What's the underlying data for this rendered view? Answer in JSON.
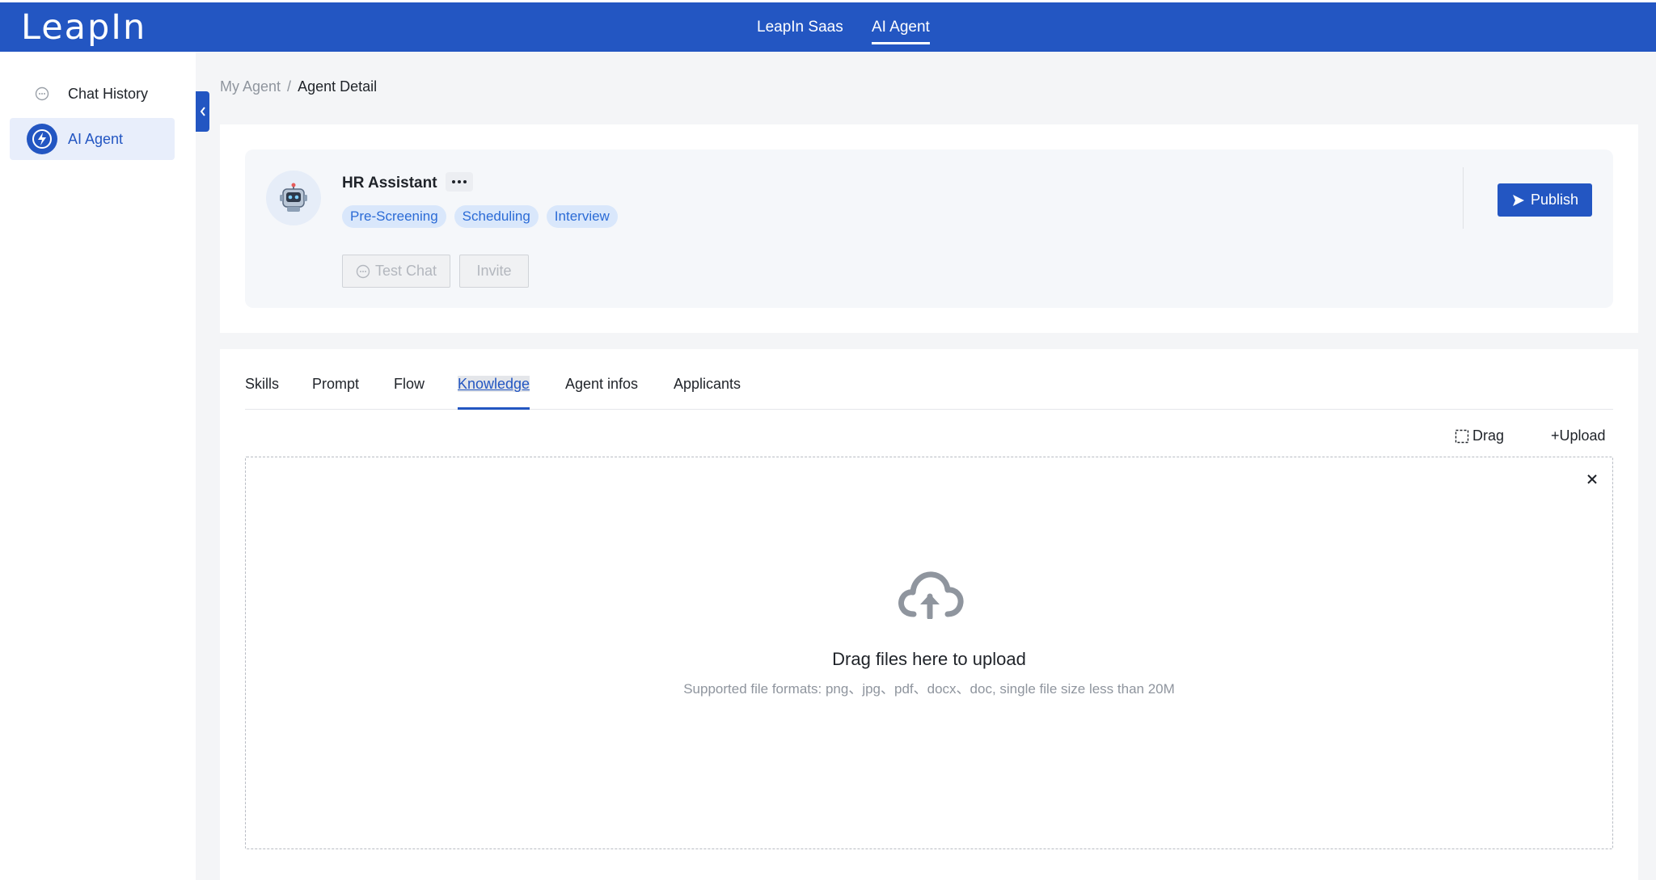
{
  "brand": {
    "logo": "LeapIn"
  },
  "topnav": {
    "items": [
      {
        "label": "LeapIn Saas"
      },
      {
        "label": "AI Agent"
      }
    ]
  },
  "sidebar": {
    "items": [
      {
        "label": "Chat History"
      },
      {
        "label": "AI Agent"
      }
    ]
  },
  "breadcrumb": {
    "parent": "My Agent",
    "separator": "/",
    "current": "Agent Detail"
  },
  "agent": {
    "name": "HR Assistant",
    "more": "···",
    "tags": [
      "Pre-Screening",
      "Scheduling",
      "Interview"
    ],
    "test_chat": "Test Chat",
    "invite": "Invite",
    "publish": "Publish"
  },
  "tabs": [
    {
      "label": "Skills"
    },
    {
      "label": "Prompt"
    },
    {
      "label": "Flow"
    },
    {
      "label": "Knowledge"
    },
    {
      "label": "Agent infos"
    },
    {
      "label": "Applicants"
    }
  ],
  "toolbar": {
    "drag": "Drag",
    "upload": "+Upload"
  },
  "dropzone": {
    "title": "Drag files here to upload",
    "subtitle": "Supported file formats: png、jpg、pdf、docx、doc, single file size less than 20M"
  },
  "colors": {
    "primary": "#2356c2",
    "tag_bg": "#d9e7fb",
    "tag_text": "#2b6bd6"
  },
  "icons": {
    "chat_history": "chat-bubble-icon",
    "ai_agent": "ai-agent-icon",
    "collapse": "chevron-left-icon",
    "avatar": "robot-icon",
    "publish": "send-icon",
    "drag": "dashed-square-icon",
    "close": "close-icon",
    "upload": "cloud-upload-icon"
  }
}
